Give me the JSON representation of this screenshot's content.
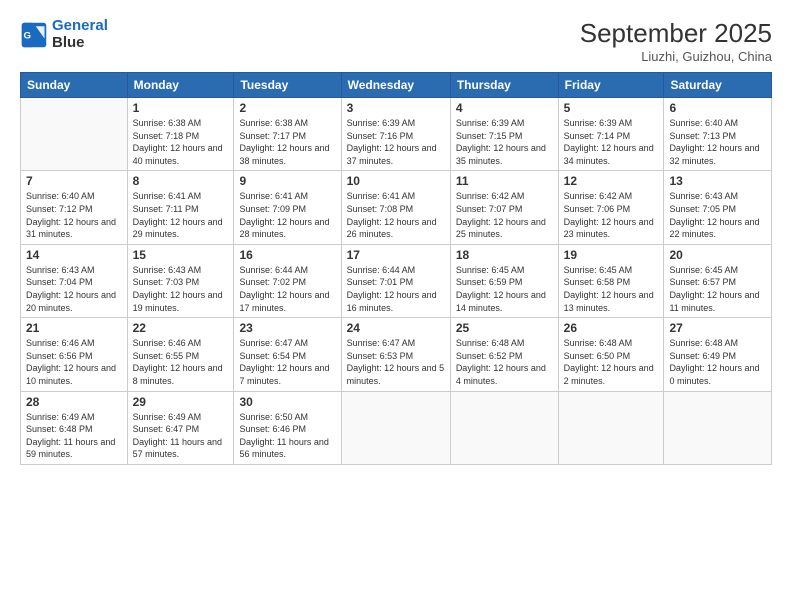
{
  "header": {
    "logo_line1": "General",
    "logo_line2": "Blue",
    "month_year": "September 2025",
    "location": "Liuzhi, Guizhou, China"
  },
  "weekdays": [
    "Sunday",
    "Monday",
    "Tuesday",
    "Wednesday",
    "Thursday",
    "Friday",
    "Saturday"
  ],
  "weeks": [
    [
      {
        "day": "",
        "sunrise": "",
        "sunset": "",
        "daylight": ""
      },
      {
        "day": "1",
        "sunrise": "Sunrise: 6:38 AM",
        "sunset": "Sunset: 7:18 PM",
        "daylight": "Daylight: 12 hours and 40 minutes."
      },
      {
        "day": "2",
        "sunrise": "Sunrise: 6:38 AM",
        "sunset": "Sunset: 7:17 PM",
        "daylight": "Daylight: 12 hours and 38 minutes."
      },
      {
        "day": "3",
        "sunrise": "Sunrise: 6:39 AM",
        "sunset": "Sunset: 7:16 PM",
        "daylight": "Daylight: 12 hours and 37 minutes."
      },
      {
        "day": "4",
        "sunrise": "Sunrise: 6:39 AM",
        "sunset": "Sunset: 7:15 PM",
        "daylight": "Daylight: 12 hours and 35 minutes."
      },
      {
        "day": "5",
        "sunrise": "Sunrise: 6:39 AM",
        "sunset": "Sunset: 7:14 PM",
        "daylight": "Daylight: 12 hours and 34 minutes."
      },
      {
        "day": "6",
        "sunrise": "Sunrise: 6:40 AM",
        "sunset": "Sunset: 7:13 PM",
        "daylight": "Daylight: 12 hours and 32 minutes."
      }
    ],
    [
      {
        "day": "7",
        "sunrise": "Sunrise: 6:40 AM",
        "sunset": "Sunset: 7:12 PM",
        "daylight": "Daylight: 12 hours and 31 minutes."
      },
      {
        "day": "8",
        "sunrise": "Sunrise: 6:41 AM",
        "sunset": "Sunset: 7:11 PM",
        "daylight": "Daylight: 12 hours and 29 minutes."
      },
      {
        "day": "9",
        "sunrise": "Sunrise: 6:41 AM",
        "sunset": "Sunset: 7:09 PM",
        "daylight": "Daylight: 12 hours and 28 minutes."
      },
      {
        "day": "10",
        "sunrise": "Sunrise: 6:41 AM",
        "sunset": "Sunset: 7:08 PM",
        "daylight": "Daylight: 12 hours and 26 minutes."
      },
      {
        "day": "11",
        "sunrise": "Sunrise: 6:42 AM",
        "sunset": "Sunset: 7:07 PM",
        "daylight": "Daylight: 12 hours and 25 minutes."
      },
      {
        "day": "12",
        "sunrise": "Sunrise: 6:42 AM",
        "sunset": "Sunset: 7:06 PM",
        "daylight": "Daylight: 12 hours and 23 minutes."
      },
      {
        "day": "13",
        "sunrise": "Sunrise: 6:43 AM",
        "sunset": "Sunset: 7:05 PM",
        "daylight": "Daylight: 12 hours and 22 minutes."
      }
    ],
    [
      {
        "day": "14",
        "sunrise": "Sunrise: 6:43 AM",
        "sunset": "Sunset: 7:04 PM",
        "daylight": "Daylight: 12 hours and 20 minutes."
      },
      {
        "day": "15",
        "sunrise": "Sunrise: 6:43 AM",
        "sunset": "Sunset: 7:03 PM",
        "daylight": "Daylight: 12 hours and 19 minutes."
      },
      {
        "day": "16",
        "sunrise": "Sunrise: 6:44 AM",
        "sunset": "Sunset: 7:02 PM",
        "daylight": "Daylight: 12 hours and 17 minutes."
      },
      {
        "day": "17",
        "sunrise": "Sunrise: 6:44 AM",
        "sunset": "Sunset: 7:01 PM",
        "daylight": "Daylight: 12 hours and 16 minutes."
      },
      {
        "day": "18",
        "sunrise": "Sunrise: 6:45 AM",
        "sunset": "Sunset: 6:59 PM",
        "daylight": "Daylight: 12 hours and 14 minutes."
      },
      {
        "day": "19",
        "sunrise": "Sunrise: 6:45 AM",
        "sunset": "Sunset: 6:58 PM",
        "daylight": "Daylight: 12 hours and 13 minutes."
      },
      {
        "day": "20",
        "sunrise": "Sunrise: 6:45 AM",
        "sunset": "Sunset: 6:57 PM",
        "daylight": "Daylight: 12 hours and 11 minutes."
      }
    ],
    [
      {
        "day": "21",
        "sunrise": "Sunrise: 6:46 AM",
        "sunset": "Sunset: 6:56 PM",
        "daylight": "Daylight: 12 hours and 10 minutes."
      },
      {
        "day": "22",
        "sunrise": "Sunrise: 6:46 AM",
        "sunset": "Sunset: 6:55 PM",
        "daylight": "Daylight: 12 hours and 8 minutes."
      },
      {
        "day": "23",
        "sunrise": "Sunrise: 6:47 AM",
        "sunset": "Sunset: 6:54 PM",
        "daylight": "Daylight: 12 hours and 7 minutes."
      },
      {
        "day": "24",
        "sunrise": "Sunrise: 6:47 AM",
        "sunset": "Sunset: 6:53 PM",
        "daylight": "Daylight: 12 hours and 5 minutes."
      },
      {
        "day": "25",
        "sunrise": "Sunrise: 6:48 AM",
        "sunset": "Sunset: 6:52 PM",
        "daylight": "Daylight: 12 hours and 4 minutes."
      },
      {
        "day": "26",
        "sunrise": "Sunrise: 6:48 AM",
        "sunset": "Sunset: 6:50 PM",
        "daylight": "Daylight: 12 hours and 2 minutes."
      },
      {
        "day": "27",
        "sunrise": "Sunrise: 6:48 AM",
        "sunset": "Sunset: 6:49 PM",
        "daylight": "Daylight: 12 hours and 0 minutes."
      }
    ],
    [
      {
        "day": "28",
        "sunrise": "Sunrise: 6:49 AM",
        "sunset": "Sunset: 6:48 PM",
        "daylight": "Daylight: 11 hours and 59 minutes."
      },
      {
        "day": "29",
        "sunrise": "Sunrise: 6:49 AM",
        "sunset": "Sunset: 6:47 PM",
        "daylight": "Daylight: 11 hours and 57 minutes."
      },
      {
        "day": "30",
        "sunrise": "Sunrise: 6:50 AM",
        "sunset": "Sunset: 6:46 PM",
        "daylight": "Daylight: 11 hours and 56 minutes."
      },
      {
        "day": "",
        "sunrise": "",
        "sunset": "",
        "daylight": ""
      },
      {
        "day": "",
        "sunrise": "",
        "sunset": "",
        "daylight": ""
      },
      {
        "day": "",
        "sunrise": "",
        "sunset": "",
        "daylight": ""
      },
      {
        "day": "",
        "sunrise": "",
        "sunset": "",
        "daylight": ""
      }
    ]
  ]
}
